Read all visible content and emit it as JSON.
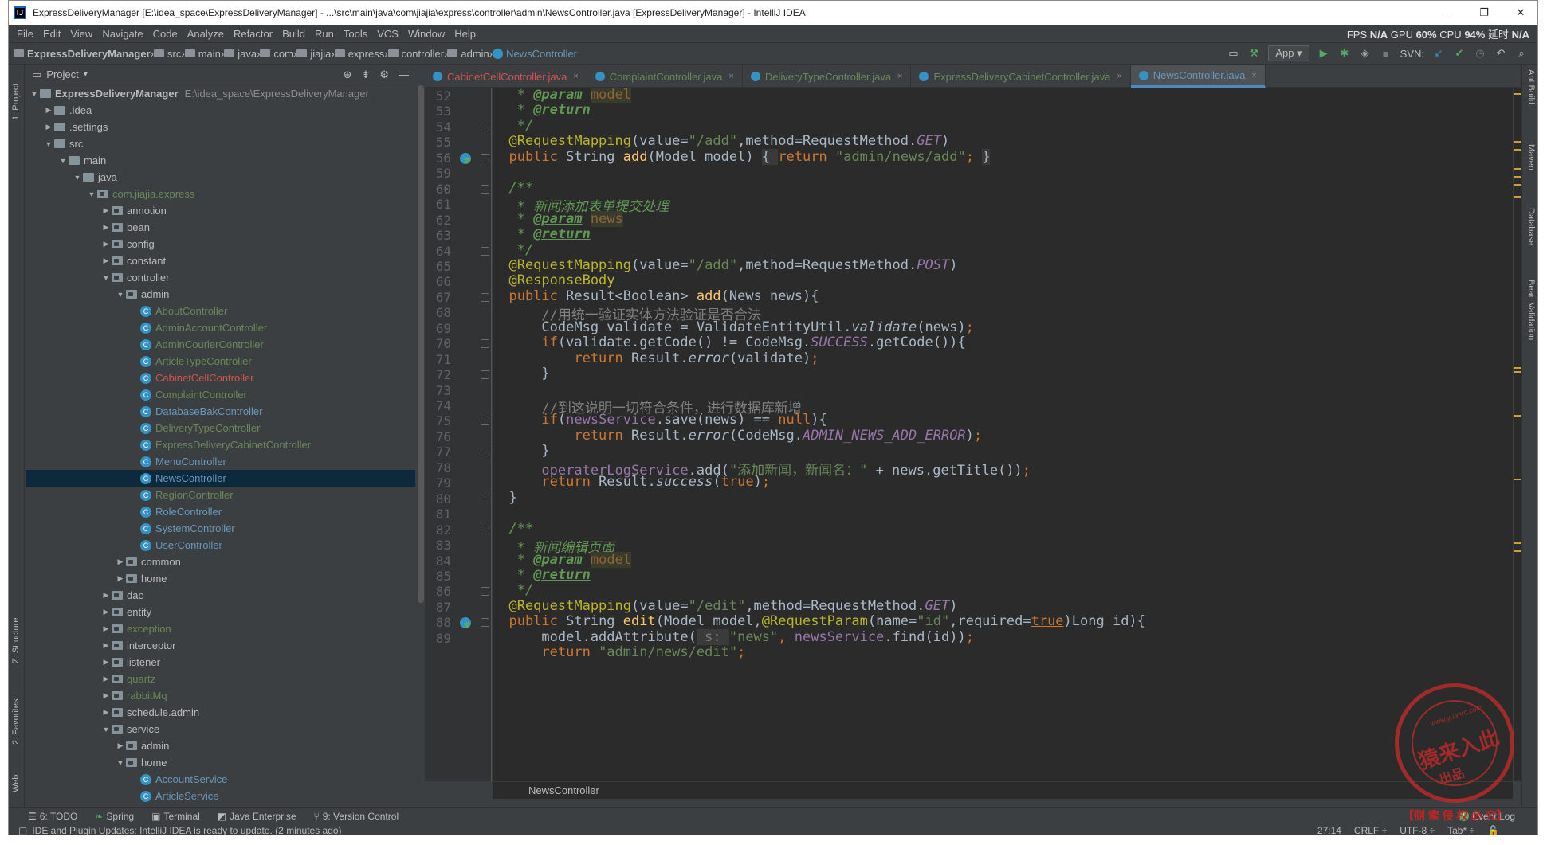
{
  "window": {
    "title": "ExpressDeliveryManager [E:\\idea_space\\ExpressDeliveryManager] - ...\\src\\main\\java\\com\\jiajia\\express\\controller\\admin\\NewsController.java [ExpressDeliveryManager] - IntelliJ IDEA",
    "app_icon": "IJ",
    "minimize": "—",
    "restore": "❐",
    "close": "✕"
  },
  "menu": [
    "File",
    "Edit",
    "View",
    "Navigate",
    "Code",
    "Analyze",
    "Refactor",
    "Build",
    "Run",
    "Tools",
    "VCS",
    "Window",
    "Help"
  ],
  "perf": {
    "fps_label": "FPS",
    "fps": "N/A",
    "gpu_label": "GPU",
    "gpu": "60%",
    "cpu_label": "CPU",
    "cpu": "94%",
    "latency_label": "延时",
    "latency": "N/A"
  },
  "nav": {
    "crumbs": [
      "ExpressDeliveryManager",
      "src",
      "main",
      "java",
      "com",
      "jiajia",
      "express",
      "controller",
      "admin",
      "NewsController"
    ],
    "run_config": "App",
    "svn_label": "SVN:"
  },
  "left_strip": {
    "project": "1: Project",
    "structure": "Z: Structure",
    "favorites": "2: Favorites",
    "web": "Web"
  },
  "right_strip": {
    "ant": "Ant Build",
    "maven": "Maven",
    "database": "Database",
    "bean": "Bean Validation"
  },
  "project": {
    "title": "Project",
    "items": [
      {
        "label": "ExpressDeliveryManager",
        "path": "E:\\idea_space\\ExpressDeliveryManager",
        "depth": 0,
        "arrow": "▼",
        "kind": "folder",
        "bold": true
      },
      {
        "label": ".idea",
        "depth": 1,
        "arrow": "▶",
        "kind": "folder"
      },
      {
        "label": ".settings",
        "depth": 1,
        "arrow": "▶",
        "kind": "folder"
      },
      {
        "label": "src",
        "depth": 1,
        "arrow": "▼",
        "kind": "folder"
      },
      {
        "label": "main",
        "depth": 2,
        "arrow": "▼",
        "kind": "folder"
      },
      {
        "label": "java",
        "depth": 3,
        "arrow": "▼",
        "kind": "folder"
      },
      {
        "label": "com.jiajia.express",
        "depth": 4,
        "arrow": "▼",
        "kind": "pkg",
        "color": "#6a8759"
      },
      {
        "label": "annotion",
        "depth": 5,
        "arrow": "▶",
        "kind": "pkg"
      },
      {
        "label": "bean",
        "depth": 5,
        "arrow": "▶",
        "kind": "pkg"
      },
      {
        "label": "config",
        "depth": 5,
        "arrow": "▶",
        "kind": "pkg"
      },
      {
        "label": "constant",
        "depth": 5,
        "arrow": "▶",
        "kind": "pkg"
      },
      {
        "label": "controller",
        "depth": 5,
        "arrow": "▼",
        "kind": "pkg"
      },
      {
        "label": "admin",
        "depth": 6,
        "arrow": "▼",
        "kind": "pkg"
      },
      {
        "label": "AboutController",
        "depth": 7,
        "kind": "class",
        "color": "#6a8759"
      },
      {
        "label": "AdminAccountController",
        "depth": 7,
        "kind": "class",
        "color": "#6a8759"
      },
      {
        "label": "AdminCourierController",
        "depth": 7,
        "kind": "class",
        "color": "#6a8759"
      },
      {
        "label": "ArticleTypeController",
        "depth": 7,
        "kind": "class",
        "color": "#6a8759"
      },
      {
        "label": "CabinetCellController",
        "depth": 7,
        "kind": "class",
        "color": "#d25252"
      },
      {
        "label": "ComplaintController",
        "depth": 7,
        "kind": "class",
        "color": "#6a8759"
      },
      {
        "label": "DatabaseBakController",
        "depth": 7,
        "kind": "class",
        "color": "#6897bb"
      },
      {
        "label": "DeliveryTypeController",
        "depth": 7,
        "kind": "class",
        "color": "#6a8759"
      },
      {
        "label": "ExpressDeliveryCabinetController",
        "depth": 7,
        "kind": "class",
        "color": "#6a8759"
      },
      {
        "label": "MenuController",
        "depth": 7,
        "kind": "class",
        "color": "#6897bb"
      },
      {
        "label": "NewsController",
        "depth": 7,
        "kind": "class",
        "color": "#6897bb",
        "selected": true
      },
      {
        "label": "RegionController",
        "depth": 7,
        "kind": "class",
        "color": "#6a8759"
      },
      {
        "label": "RoleController",
        "depth": 7,
        "kind": "class",
        "color": "#6897bb"
      },
      {
        "label": "SystemController",
        "depth": 7,
        "kind": "class",
        "color": "#6897bb"
      },
      {
        "label": "UserController",
        "depth": 7,
        "kind": "class",
        "color": "#6897bb"
      },
      {
        "label": "common",
        "depth": 6,
        "arrow": "▶",
        "kind": "pkg"
      },
      {
        "label": "home",
        "depth": 6,
        "arrow": "▶",
        "kind": "pkg"
      },
      {
        "label": "dao",
        "depth": 5,
        "arrow": "▶",
        "kind": "pkg"
      },
      {
        "label": "entity",
        "depth": 5,
        "arrow": "▶",
        "kind": "pkg"
      },
      {
        "label": "exception",
        "depth": 5,
        "arrow": "▶",
        "kind": "pkg",
        "color": "#6a8759"
      },
      {
        "label": "interceptor",
        "depth": 5,
        "arrow": "▶",
        "kind": "pkg"
      },
      {
        "label": "listener",
        "depth": 5,
        "arrow": "▶",
        "kind": "pkg"
      },
      {
        "label": "quartz",
        "depth": 5,
        "arrow": "▶",
        "kind": "pkg",
        "color": "#6a8759"
      },
      {
        "label": "rabbitMq",
        "depth": 5,
        "arrow": "▶",
        "kind": "pkg",
        "color": "#6a8759"
      },
      {
        "label": "schedule.admin",
        "depth": 5,
        "arrow": "▶",
        "kind": "pkg"
      },
      {
        "label": "service",
        "depth": 5,
        "arrow": "▼",
        "kind": "pkg"
      },
      {
        "label": "admin",
        "depth": 6,
        "arrow": "▶",
        "kind": "pkg"
      },
      {
        "label": "home",
        "depth": 6,
        "arrow": "▼",
        "kind": "pkg"
      },
      {
        "label": "AccountService",
        "depth": 7,
        "kind": "class",
        "color": "#6897bb"
      },
      {
        "label": "ArticleService",
        "depth": 7,
        "kind": "class",
        "color": "#6897bb"
      }
    ]
  },
  "tabs": [
    {
      "label": "CabinetCellController.java",
      "color": "#d25252"
    },
    {
      "label": "ComplaintController.java",
      "color": "#6a8759"
    },
    {
      "label": "DeliveryTypeController.java",
      "color": "#6a8759"
    },
    {
      "label": "ExpressDeliveryCabinetController.java",
      "color": "#6a8759"
    },
    {
      "label": "NewsController.java",
      "color": "#6897bb",
      "active": true
    }
  ],
  "code": {
    "first_line": 52,
    "line_numbers": [
      "52",
      "53",
      "54",
      "55",
      "56",
      "59",
      "60",
      "61",
      "62",
      "63",
      "64",
      "65",
      "66",
      "67",
      "68",
      "69",
      "70",
      "71",
      "72",
      "73",
      "74",
      "75",
      "76",
      "77",
      "78",
      "79",
      "80",
      "81",
      "82",
      "83",
      "84",
      "85",
      "86",
      "87",
      "88",
      "89"
    ],
    "lines": [
      [
        {
          "t": "   * ",
          "c": "#629755",
          "i": true
        },
        {
          "t": "@param",
          "c": "#629755",
          "i": true,
          "u": true,
          "b": true
        },
        {
          "t": " ",
          "c": "#629755"
        },
        {
          "t": "model",
          "c": "#8a653b",
          "bg": "#3b3b2b"
        }
      ],
      [
        {
          "t": "   * ",
          "c": "#629755",
          "i": true
        },
        {
          "t": "@return",
          "c": "#629755",
          "i": true,
          "u": true,
          "b": true
        }
      ],
      [
        {
          "t": "   */",
          "c": "#629755",
          "i": true
        }
      ],
      [
        {
          "t": "  @RequestMapping",
          "c": "#bbb529"
        },
        {
          "t": "(value=",
          "c": "#a9b7c6"
        },
        {
          "t": "\"/add\"",
          "c": "#6a8759"
        },
        {
          "t": ",method=RequestMethod.",
          "c": "#a9b7c6"
        },
        {
          "t": "GET",
          "c": "#9876aa",
          "i": true
        },
        {
          "t": ")",
          "c": "#a9b7c6"
        }
      ],
      [
        {
          "t": "  public ",
          "c": "#cc7832"
        },
        {
          "t": "String ",
          "c": "#a9b7c6"
        },
        {
          "t": "add",
          "c": "#ffc66d"
        },
        {
          "t": "(Model ",
          "c": "#a9b7c6"
        },
        {
          "t": "model",
          "c": "#a9b7c6",
          "u": true
        },
        {
          "t": ") ",
          "c": "#a9b7c6"
        },
        {
          "t": "{ ",
          "c": "#a9b7c6",
          "bg": "#3a3a3a"
        },
        {
          "t": "return ",
          "c": "#cc7832"
        },
        {
          "t": "\"admin/news/add\"",
          "c": "#6a8759"
        },
        {
          "t": "; ",
          "c": "#cc7832"
        },
        {
          "t": "}",
          "c": "#a9b7c6",
          "bg": "#3a3a3a"
        }
      ],
      [
        {
          "t": "",
          "c": "#a9b7c6"
        }
      ],
      [
        {
          "t": "  /**",
          "c": "#629755",
          "i": true
        }
      ],
      [
        {
          "t": "   * ",
          "c": "#629755",
          "i": true
        },
        {
          "t": "新闻添加表单提交处理",
          "c": "#629755",
          "i": true
        }
      ],
      [
        {
          "t": "   * ",
          "c": "#629755",
          "i": true
        },
        {
          "t": "@param",
          "c": "#629755",
          "i": true,
          "u": true,
          "b": true
        },
        {
          "t": " ",
          "c": "#629755"
        },
        {
          "t": "news",
          "c": "#8a653b",
          "bg": "#3b3b2b"
        }
      ],
      [
        {
          "t": "   * ",
          "c": "#629755",
          "i": true
        },
        {
          "t": "@return",
          "c": "#629755",
          "i": true,
          "u": true,
          "b": true
        }
      ],
      [
        {
          "t": "   */",
          "c": "#629755",
          "i": true
        }
      ],
      [
        {
          "t": "  @RequestMapping",
          "c": "#bbb529"
        },
        {
          "t": "(value=",
          "c": "#a9b7c6"
        },
        {
          "t": "\"/add\"",
          "c": "#6a8759"
        },
        {
          "t": ",method=RequestMethod.",
          "c": "#a9b7c6"
        },
        {
          "t": "POST",
          "c": "#9876aa",
          "i": true
        },
        {
          "t": ")",
          "c": "#a9b7c6"
        }
      ],
      [
        {
          "t": "  @ResponseBody",
          "c": "#bbb529"
        }
      ],
      [
        {
          "t": "  public ",
          "c": "#cc7832"
        },
        {
          "t": "Result<Boolean> ",
          "c": "#a9b7c6"
        },
        {
          "t": "add",
          "c": "#ffc66d"
        },
        {
          "t": "(News news){",
          "c": "#a9b7c6"
        }
      ],
      [
        {
          "t": "      //用统一验证实体方法验证是否合法",
          "c": "#808080"
        }
      ],
      [
        {
          "t": "      CodeMsg validate = ValidateEntityUtil.",
          "c": "#a9b7c6"
        },
        {
          "t": "validate",
          "c": "#a9b7c6",
          "i": true
        },
        {
          "t": "(news)",
          "c": "#a9b7c6"
        },
        {
          "t": ";",
          "c": "#cc7832"
        }
      ],
      [
        {
          "t": "      if",
          "c": "#cc7832"
        },
        {
          "t": "(validate.getCode() != CodeMsg.",
          "c": "#a9b7c6"
        },
        {
          "t": "SUCCESS",
          "c": "#9876aa",
          "i": true
        },
        {
          "t": ".getCode()){",
          "c": "#a9b7c6"
        }
      ],
      [
        {
          "t": "          return ",
          "c": "#cc7832"
        },
        {
          "t": "Result.",
          "c": "#a9b7c6"
        },
        {
          "t": "error",
          "c": "#a9b7c6",
          "i": true
        },
        {
          "t": "(validate)",
          "c": "#a9b7c6"
        },
        {
          "t": ";",
          "c": "#cc7832"
        }
      ],
      [
        {
          "t": "      }",
          "c": "#a9b7c6"
        }
      ],
      [
        {
          "t": "",
          "c": "#a9b7c6"
        }
      ],
      [
        {
          "t": "      //到这说明一切符合条件，进行数据库新增",
          "c": "#808080"
        }
      ],
      [
        {
          "t": "      if",
          "c": "#cc7832"
        },
        {
          "t": "(",
          "c": "#a9b7c6"
        },
        {
          "t": "newsService",
          "c": "#9876aa"
        },
        {
          "t": ".save(news) == ",
          "c": "#a9b7c6"
        },
        {
          "t": "null",
          "c": "#cc7832"
        },
        {
          "t": "){",
          "c": "#a9b7c6"
        }
      ],
      [
        {
          "t": "          return ",
          "c": "#cc7832"
        },
        {
          "t": "Result.",
          "c": "#a9b7c6"
        },
        {
          "t": "error",
          "c": "#a9b7c6",
          "i": true
        },
        {
          "t": "(CodeMsg.",
          "c": "#a9b7c6"
        },
        {
          "t": "ADMIN_NEWS_ADD_ERROR",
          "c": "#9876aa",
          "i": true
        },
        {
          "t": ")",
          "c": "#a9b7c6"
        },
        {
          "t": ";",
          "c": "#cc7832"
        }
      ],
      [
        {
          "t": "      }",
          "c": "#a9b7c6"
        }
      ],
      [
        {
          "t": "      ",
          "c": "#a9b7c6"
        },
        {
          "t": "operaterLogService",
          "c": "#9876aa"
        },
        {
          "t": ".add(",
          "c": "#a9b7c6"
        },
        {
          "t": "\"添加新闻，新闻名：\"",
          "c": "#6a8759"
        },
        {
          "t": " + news.getTitle())",
          "c": "#a9b7c6"
        },
        {
          "t": ";",
          "c": "#cc7832"
        }
      ],
      [
        {
          "t": "      return ",
          "c": "#cc7832"
        },
        {
          "t": "Result.",
          "c": "#a9b7c6"
        },
        {
          "t": "success",
          "c": "#a9b7c6",
          "i": true
        },
        {
          "t": "(",
          "c": "#a9b7c6"
        },
        {
          "t": "true",
          "c": "#cc7832"
        },
        {
          "t": ")",
          "c": "#a9b7c6"
        },
        {
          "t": ";",
          "c": "#cc7832"
        }
      ],
      [
        {
          "t": "  }",
          "c": "#a9b7c6"
        }
      ],
      [
        {
          "t": "",
          "c": "#a9b7c6"
        }
      ],
      [
        {
          "t": "  /**",
          "c": "#629755",
          "i": true
        }
      ],
      [
        {
          "t": "   * ",
          "c": "#629755",
          "i": true
        },
        {
          "t": "新闻编辑页面",
          "c": "#629755",
          "i": true
        }
      ],
      [
        {
          "t": "   * ",
          "c": "#629755",
          "i": true
        },
        {
          "t": "@param",
          "c": "#629755",
          "i": true,
          "u": true,
          "b": true
        },
        {
          "t": " ",
          "c": "#629755"
        },
        {
          "t": "model",
          "c": "#8a653b",
          "bg": "#3b3b2b"
        }
      ],
      [
        {
          "t": "   * ",
          "c": "#629755",
          "i": true
        },
        {
          "t": "@return",
          "c": "#629755",
          "i": true,
          "u": true,
          "b": true
        }
      ],
      [
        {
          "t": "   */",
          "c": "#629755",
          "i": true
        }
      ],
      [
        {
          "t": "  @RequestMapping",
          "c": "#bbb529"
        },
        {
          "t": "(value=",
          "c": "#a9b7c6"
        },
        {
          "t": "\"/edit\"",
          "c": "#6a8759"
        },
        {
          "t": ",method=RequestMethod.",
          "c": "#a9b7c6"
        },
        {
          "t": "GET",
          "c": "#9876aa",
          "i": true
        },
        {
          "t": ")",
          "c": "#a9b7c6"
        }
      ],
      [
        {
          "t": "  public ",
          "c": "#cc7832"
        },
        {
          "t": "String ",
          "c": "#a9b7c6"
        },
        {
          "t": "edit",
          "c": "#ffc66d"
        },
        {
          "t": "(Model model,",
          "c": "#a9b7c6"
        },
        {
          "t": "@RequestParam",
          "c": "#bbb529"
        },
        {
          "t": "(name=",
          "c": "#a9b7c6"
        },
        {
          "t": "\"id\"",
          "c": "#6a8759"
        },
        {
          "t": ",required=",
          "c": "#a9b7c6"
        },
        {
          "t": "true",
          "c": "#cc7832",
          "u": true
        },
        {
          "t": ")Long id){",
          "c": "#a9b7c6"
        }
      ],
      [
        {
          "t": "      model.addAttribute(",
          "c": "#a9b7c6"
        },
        {
          "t": " s: ",
          "c": "#787878",
          "bg": "#3b3b3b"
        },
        {
          "t": "\"news\"",
          "c": "#6a8759"
        },
        {
          "t": ", ",
          "c": "#cc7832"
        },
        {
          "t": "newsService",
          "c": "#9876aa"
        },
        {
          "t": ".find(id))",
          "c": "#a9b7c6"
        },
        {
          "t": ";",
          "c": "#cc7832"
        }
      ],
      [
        {
          "t": "      return ",
          "c": "#cc7832"
        },
        {
          "t": "\"admin/news/edit\"",
          "c": "#6a8759"
        },
        {
          "t": ";",
          "c": "#cc7832"
        }
      ]
    ],
    "bottom_crumb": "NewsController"
  },
  "bottom_tools": {
    "todo": "6: TODO",
    "spring": "Spring",
    "terminal": "Terminal",
    "javaee": "Java Enterprise",
    "vcs": "9: Version Control",
    "eventlog": "Event Log",
    "eventlog_count": "1"
  },
  "status": {
    "message": "IDE and Plugin Updates: IntelliJ IDEA is ready to update. (2 minutes ago)",
    "position": "27:14",
    "line_sep": "CRLF ÷",
    "encoding": "UTF-8 ÷",
    "indent": "Tab* ÷"
  },
  "watermark": {
    "main": "猿来入此",
    "sub": "出品",
    "url": "www.yuanrc.com",
    "bar": "【侧 索 侵 权 必 究】"
  }
}
